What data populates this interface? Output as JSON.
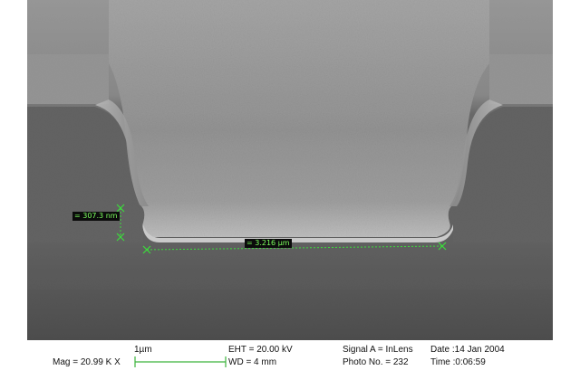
{
  "measurements": {
    "height": "= 307.3 nm",
    "width": "= 3.216 µm"
  },
  "databar": {
    "scale_label": "1µm",
    "mag": "Mag =  20.99 K X",
    "eht": "EHT = 20.00 kV",
    "wd": "WD =    4 mm",
    "signal": "Signal A = InLens",
    "photo": "Photo No. = 232",
    "date": "Date :14 Jan 2004",
    "time": "Time :0:06:59"
  },
  "colors": {
    "measure": "#3cdc3c",
    "label_bg": "#0b0b0b",
    "label_text": "#7cff5e"
  }
}
